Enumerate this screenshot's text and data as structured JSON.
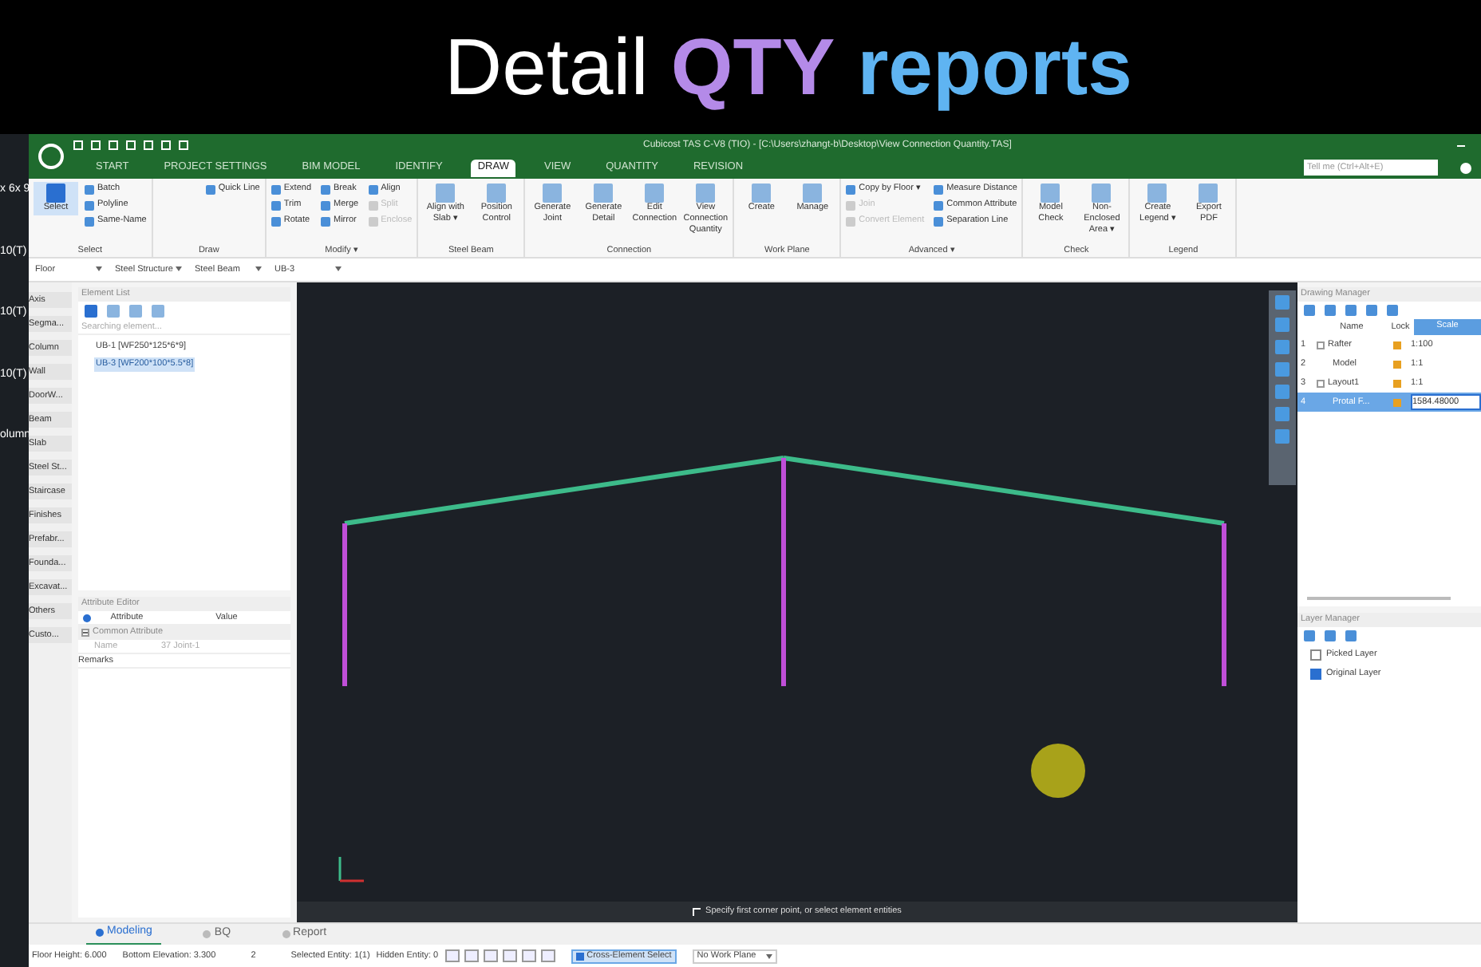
{
  "banner": {
    "parts": [
      {
        "text": "Detail",
        "color": "#ffffff"
      },
      {
        "text": "QTY",
        "color": "#b48ae8"
      },
      {
        "text": "reports",
        "color": "#5fb4f2"
      }
    ]
  },
  "background_fragments": [
    "x 6x 9",
    "10(T)",
    "10(T)",
    "10(T)",
    "olumn"
  ],
  "window": {
    "title": "Cubicost TAS C-V8 (TIO) - [C:\\Users\\zhangt-b\\Desktop\\View Connection Quantity.TAS]",
    "search": {
      "placeholder": "Tell me (Ctrl+Alt+E)"
    }
  },
  "tabs": [
    {
      "label": "START",
      "selected": false
    },
    {
      "label": "PROJECT SETTINGS",
      "selected": false
    },
    {
      "label": "BIM MODEL",
      "selected": false
    },
    {
      "label": "IDENTIFY",
      "selected": false
    },
    {
      "label": "DRAW",
      "selected": true
    },
    {
      "label": "VIEW",
      "selected": false
    },
    {
      "label": "QUANTITY",
      "selected": false
    },
    {
      "label": "REVISION",
      "selected": false
    }
  ],
  "ribbon": [
    {
      "name": "Select",
      "big": [
        {
          "label": "Select",
          "selected": true
        }
      ],
      "small": [
        {
          "label": "Batch",
          "disabled": false
        },
        {
          "label": "Polyline",
          "disabled": false
        },
        {
          "label": "Same-Name",
          "disabled": false
        }
      ]
    },
    {
      "name": "Draw",
      "small": [
        {
          "label": "Quick Line",
          "disabled": false
        }
      ]
    },
    {
      "name": "Modify ▾",
      "small": [
        {
          "label": "Extend",
          "disabled": false
        },
        {
          "label": "Trim",
          "disabled": false
        },
        {
          "label": "Rotate",
          "disabled": false
        },
        {
          "label": "Break",
          "disabled": false
        },
        {
          "label": "Merge",
          "disabled": false
        },
        {
          "label": "Mirror",
          "disabled": false
        },
        {
          "label": "Align",
          "disabled": false
        },
        {
          "label": "Split",
          "disabled": true
        },
        {
          "label": "Enclose",
          "disabled": true
        }
      ]
    },
    {
      "name": "Steel Beam",
      "big": [
        {
          "label": "Align with Slab ▾",
          "selected": false
        },
        {
          "label": "Position Control",
          "selected": false
        }
      ]
    },
    {
      "name": "Connection",
      "big": [
        {
          "label": "Generate Joint",
          "selected": false
        },
        {
          "label": "Generate Detail",
          "selected": false
        },
        {
          "label": "Edit Connection",
          "selected": false
        },
        {
          "label": "View Connection Quantity",
          "selected": false
        }
      ]
    },
    {
      "name": "Work Plane",
      "big": [
        {
          "label": "Create",
          "selected": false
        },
        {
          "label": "Manage",
          "selected": false
        }
      ]
    },
    {
      "name": "Advanced ▾",
      "small": [
        {
          "label": "Copy by Floor ▾",
          "disabled": false
        },
        {
          "label": "Join",
          "disabled": true
        },
        {
          "label": "Convert Element",
          "disabled": true
        },
        {
          "label": "Measure Distance",
          "disabled": false
        },
        {
          "label": "Common Attribute",
          "disabled": false
        },
        {
          "label": "Separation Line",
          "disabled": false
        }
      ]
    },
    {
      "name": "Check",
      "big": [
        {
          "label": "Model Check",
          "selected": false
        },
        {
          "label": "Non-Enclosed Area ▾",
          "selected": false
        }
      ]
    },
    {
      "name": "Legend",
      "big": [
        {
          "label": "Create Legend ▾",
          "selected": false
        },
        {
          "label": "Export PDF",
          "selected": false
        }
      ]
    }
  ],
  "filters": [
    "Floor",
    "Steel Structure",
    "Steel Beam",
    "UB-3"
  ],
  "categories": [
    "Axis",
    "Segma...",
    "Column",
    "Wall",
    "DoorW...",
    "Beam",
    "Slab",
    "Steel St...",
    "Staircase",
    "Finishes",
    "Prefabr...",
    "Founda...",
    "Excavat...",
    "Others",
    "Custo..."
  ],
  "element_list": {
    "title": "Element List",
    "search": {
      "placeholder": "Searching element..."
    },
    "items": [
      {
        "label": "UB-1 [WF250*125*6*9]",
        "selected": false
      },
      {
        "label": "UB-3 [WF200*100*5.5*8]",
        "selected": true
      }
    ]
  },
  "attribute_editor": {
    "title": "Attribute Editor",
    "columns": [
      "Attribute",
      "Value"
    ],
    "group": {
      "label": "Common Attribute",
      "expanded": true
    },
    "rows": [
      {
        "attribute": "Name",
        "value": "37 Joint-1",
        "disabled": true
      },
      {
        "attribute": "Remarks",
        "disabled": false
      }
    ]
  },
  "canvas": {
    "prompt": "Specify first corner point, or select element entities"
  },
  "drawing_manager": {
    "title": "Drawing Manager",
    "columns": [
      "Name",
      "Lock",
      "Scale"
    ],
    "rows": [
      {
        "index": "1",
        "name": "Rafter",
        "expanded": true,
        "scale": "1:100",
        "selected": false
      },
      {
        "index": "2",
        "name": "Model",
        "scale": "1:1",
        "selected": false
      },
      {
        "index": "3",
        "name": "Layout1",
        "expanded": true,
        "scale": "1:1",
        "selected": false
      },
      {
        "index": "4",
        "name": "Protal F...",
        "scale": "1584.48000",
        "selected": true
      }
    ]
  },
  "layer_manager": {
    "title": "Layer Manager",
    "layers": [
      {
        "label": "Picked Layer",
        "checked": false
      },
      {
        "label": "Original Layer",
        "checked": true
      }
    ]
  },
  "bottom_tabs": [
    {
      "label": "Modeling",
      "selected": true
    },
    {
      "label": "BQ",
      "selected": false
    },
    {
      "label": "Report",
      "selected": false
    }
  ],
  "status_bar": {
    "floor_height": "Floor Height: 6.000",
    "bottom_elevation": "Bottom Elevation: 3.300",
    "count": "2",
    "selected_entity": "Selected Entity: 1(1)",
    "hidden_entity": "Hidden Entity: 0",
    "cross_select": {
      "label": "Cross-Element Select",
      "checked": true
    },
    "work_plane": "No Work Plane"
  }
}
